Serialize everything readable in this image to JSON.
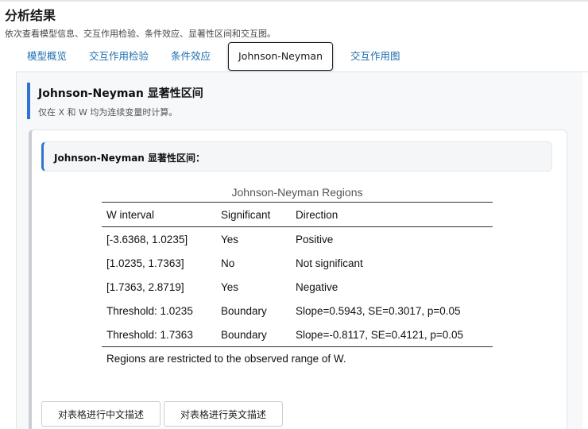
{
  "header": {
    "title": "分析结果",
    "subtitle": "依次查看模型信息、交互作用检验、条件效应、显著性区间和交互图。"
  },
  "tabs": [
    {
      "label": "模型概览",
      "active": false
    },
    {
      "label": "交互作用检验",
      "active": false
    },
    {
      "label": "条件效应",
      "active": false
    },
    {
      "label": "Johnson-Neyman",
      "active": true
    },
    {
      "label": "交互作用图",
      "active": false
    }
  ],
  "section": {
    "title": "Johnson-Neyman 显著性区间",
    "note": "仅在 X 和 W 均为连续变量时计算。"
  },
  "card": {
    "header": "Johnson-Neyman 显著性区间："
  },
  "table": {
    "caption": "Johnson-Neyman Regions",
    "columns": [
      "W interval",
      "Significant",
      "Direction"
    ],
    "rows": [
      [
        "[-3.6368, 1.0235]",
        "Yes",
        "Positive"
      ],
      [
        "[1.0235, 1.7363]",
        "No",
        "Not significant"
      ],
      [
        "[1.7363, 2.8719]",
        "Yes",
        "Negative"
      ],
      [
        "Threshold: 1.0235",
        "Boundary",
        "Slope=0.5943, SE=0.3017, p=0.05"
      ],
      [
        "Threshold: 1.7363",
        "Boundary",
        "Slope=-0.8117, SE=0.4121, p=0.05"
      ]
    ],
    "note": "Regions are restricted to the observed range of W."
  },
  "buttons": {
    "describe_cn": "对表格进行中文描述",
    "describe_en": "对表格进行英文描述"
  },
  "colors": {
    "accent": "#2f74d0",
    "tab_link": "#1f6fb0"
  }
}
